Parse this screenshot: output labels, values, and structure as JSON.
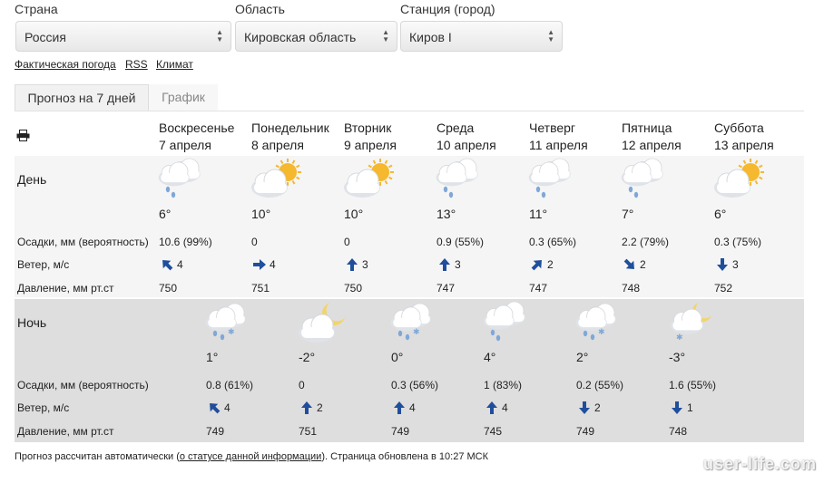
{
  "filters": {
    "country": {
      "label": "Страна",
      "value": "Россия"
    },
    "region": {
      "label": "Область",
      "value": "Кировская область"
    },
    "station": {
      "label": "Станция (город)",
      "value": "Киров I"
    }
  },
  "links": [
    "Фактическая погода",
    "RSS",
    "Климат"
  ],
  "tabs": {
    "forecast": "Прогноз на 7 дней",
    "chart": "График"
  },
  "print_icon": "printer-icon",
  "days": [
    {
      "name": "Воскресенье",
      "date": "7 апреля"
    },
    {
      "name": "Понедельник",
      "date": "8 апреля"
    },
    {
      "name": "Вторник",
      "date": "9 апреля"
    },
    {
      "name": "Среда",
      "date": "10 апреля"
    },
    {
      "name": "Четверг",
      "date": "11 апреля"
    },
    {
      "name": "Пятница",
      "date": "12 апреля"
    },
    {
      "name": "Суббота",
      "date": "13 апреля"
    }
  ],
  "labels": {
    "day": "День",
    "night": "Ночь",
    "precip": "Осадки, мм (вероятность)",
    "wind": "Ветер, м/с",
    "pressure": "Давление, мм рт.ст"
  },
  "day_rows": {
    "icons": [
      "cloud-rain-icon",
      "sun-cloud-icon",
      "sun-cloud-icon",
      "cloud-rain-icon",
      "cloud-rain-icon",
      "cloud-rain-icon",
      "sun-cloud-icon"
    ],
    "temps": [
      "6°",
      "10°",
      "10°",
      "13°",
      "11°",
      "7°",
      "6°"
    ],
    "precip": [
      "10.6 (99%)",
      "0",
      "0",
      "0.9 (55%)",
      "0.3 (65%)",
      "2.2 (79%)",
      "0.3 (75%)"
    ],
    "wind_dir": [
      "nw",
      "e",
      "n",
      "n",
      "ne",
      "se",
      "s"
    ],
    "wind": [
      "4",
      "4",
      "3",
      "3",
      "2",
      "2",
      "3"
    ],
    "pressure": [
      "750",
      "751",
      "750",
      "747",
      "747",
      "748",
      "752"
    ]
  },
  "night_rows": {
    "icons": [
      "cloud-rain-snow-icon",
      "moon-cloud-icon",
      "cloud-rain-snow-icon",
      "cloud-rain-icon",
      "cloud-rain-snow-icon",
      "moon-cloud-snow-icon"
    ],
    "temps": [
      "1°",
      "-2°",
      "0°",
      "4°",
      "2°",
      "-3°"
    ],
    "precip": [
      "0.8 (61%)",
      "0",
      "0.3 (56%)",
      "1 (83%)",
      "0.2 (55%)",
      "1.6 (55%)"
    ],
    "wind_dir": [
      "nw",
      "n",
      "n",
      "n",
      "s",
      "s"
    ],
    "wind": [
      "4",
      "2",
      "4",
      "4",
      "2",
      "1"
    ],
    "pressure": [
      "749",
      "751",
      "749",
      "745",
      "749",
      "748"
    ]
  },
  "footer": {
    "before": "Прогноз рассчитан автоматически (",
    "link": "о статусе данной информации",
    "after": "). Страница обновлена в 10:27 МСК"
  },
  "watermark": "user-life.com",
  "colors": {
    "arrow": "#1f4f9c",
    "sun": "#f5b82e",
    "cloud": "#ffffff",
    "rain": "#7fa8d8"
  }
}
